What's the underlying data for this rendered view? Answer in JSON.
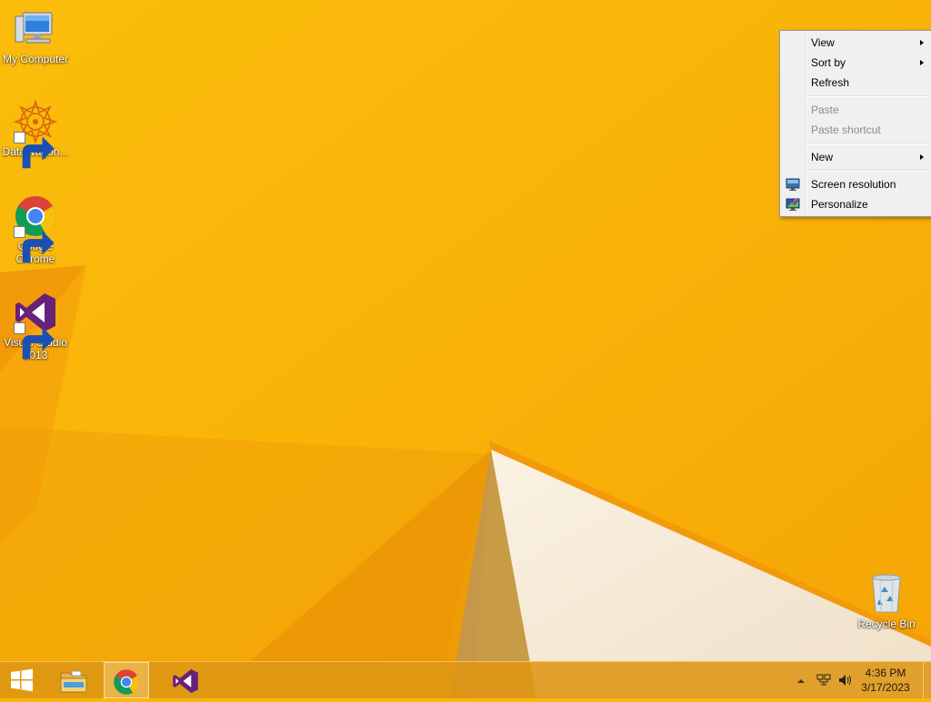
{
  "desktop": {
    "icons": [
      {
        "label": "My Computer",
        "icon": "computer-icon",
        "shortcut": false
      },
      {
        "label": "DataWagon...",
        "icon": "datawagon-icon",
        "shortcut": true
      },
      {
        "label": "Google Chrome",
        "icon": "chrome-icon",
        "shortcut": true
      },
      {
        "label": "Visual Studio 2013",
        "icon": "visual-studio-icon",
        "shortcut": true
      },
      {
        "label": "Recycle Bin",
        "icon": "recycle-bin-icon",
        "shortcut": false
      }
    ]
  },
  "context_menu": {
    "items": [
      {
        "label": "View",
        "submenu": true,
        "enabled": true
      },
      {
        "label": "Sort by",
        "submenu": true,
        "enabled": true
      },
      {
        "label": "Refresh",
        "submenu": false,
        "enabled": true
      },
      {
        "label": "Paste",
        "submenu": false,
        "enabled": false
      },
      {
        "label": "Paste shortcut",
        "submenu": false,
        "enabled": false
      },
      {
        "label": "New",
        "submenu": true,
        "enabled": true
      },
      {
        "label": "Screen resolution",
        "submenu": false,
        "enabled": true,
        "icon": "screen-resolution-icon"
      },
      {
        "label": "Personalize",
        "submenu": false,
        "enabled": true,
        "icon": "personalize-icon"
      }
    ]
  },
  "taskbar": {
    "start_icon": "windows-logo-icon",
    "pinned": [
      {
        "icon": "file-explorer-icon",
        "active": false
      },
      {
        "icon": "chrome-icon",
        "active": true
      },
      {
        "icon": "visual-studio-icon",
        "active": false
      }
    ],
    "tray": {
      "icons": [
        "show-hidden-icons-chevron",
        "network-icon",
        "volume-icon"
      ],
      "time": "4:36 PM",
      "date": "3/17/2023"
    }
  },
  "colors": {
    "wallpaper": "#f9b80a",
    "taskbar": "#de9614",
    "menu_bg": "#f0f0f0"
  }
}
